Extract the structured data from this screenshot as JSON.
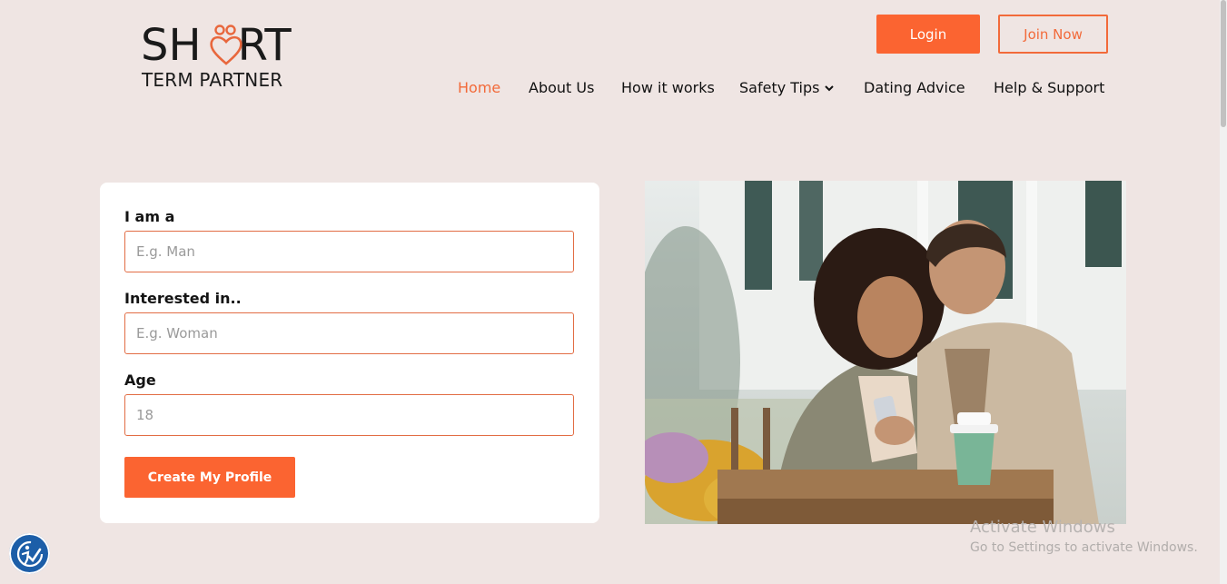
{
  "logo": {
    "line1_left": "SH",
    "line1_right": "RT",
    "line2": "TERM PARTNER"
  },
  "header": {
    "login_label": "Login",
    "join_label": "Join Now"
  },
  "nav": {
    "items": [
      {
        "label": "Home",
        "active": true
      },
      {
        "label": "About Us"
      },
      {
        "label": "How it works"
      },
      {
        "label": "Safety Tips",
        "has_dropdown": true
      },
      {
        "label": "Dating Advice"
      },
      {
        "label": "Help & Support"
      }
    ]
  },
  "form": {
    "fields": [
      {
        "label": "I am a",
        "placeholder": "E.g. Man",
        "value": ""
      },
      {
        "label": "Interested in..",
        "placeholder": "E.g. Woman",
        "value": ""
      },
      {
        "label": "Age",
        "placeholder": "18",
        "value": ""
      }
    ],
    "submit_label": "Create My Profile"
  },
  "watermark": {
    "title": "Activate Windows",
    "subtitle": "Go to Settings to activate Windows."
  },
  "colors": {
    "accent": "#fb6431",
    "background": "#efe5e3",
    "accessibility_button": "#1c5ea8"
  },
  "icons": {
    "logo_heart": "heart-people-icon",
    "dropdown": "chevron-down-icon",
    "accessibility": "accessibility-icon"
  }
}
